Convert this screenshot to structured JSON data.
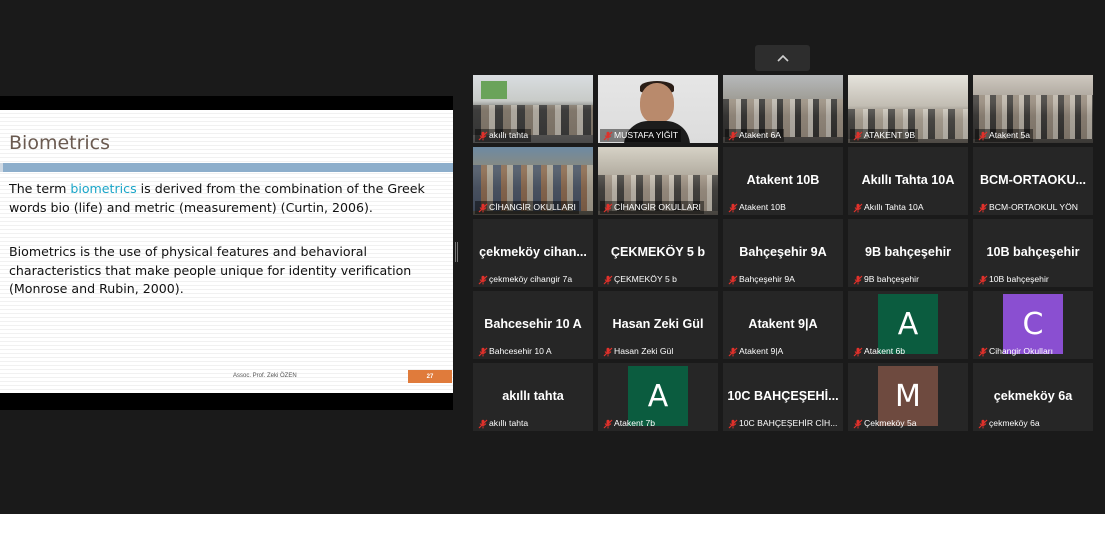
{
  "gallery_toggle": {
    "icon": "chevron-up-icon"
  },
  "slide": {
    "title": "Biometrics",
    "p1_before": "The term ",
    "p1_highlight": "biometrics",
    "p1_after": " is derived from the combination of the Greek words bio (life) and metric (measurement) (Curtin, 2006).",
    "p2": "Biometrics is the use of physical features and behavioral characteristics that make people unique for identity verification (Monrose and Rubin, 2000).",
    "footer": "Assoc. Prof. Zeki ÖZEN",
    "page": "27",
    "colors": {
      "title": "#6a5a50",
      "bar": "#8daecb",
      "highlight": "#1aa5c8",
      "page_badge": "#e07b3b"
    }
  },
  "participants": [
    {
      "name": "akıllı tahta",
      "video": "v-class1"
    },
    {
      "name": "MUSTAFA YİĞİT",
      "video": "v-person"
    },
    {
      "name": "Atakent 6A",
      "video": "v-class2"
    },
    {
      "name": "ATAKENT 9B",
      "video": "v-class3"
    },
    {
      "name": "Atakent 5a",
      "video": "v-class4"
    },
    {
      "name": "CİHANGİR OKULLARI",
      "video": "v-class5"
    },
    {
      "name": "CİHANGİR OKULLARI",
      "video": "v-class6"
    },
    {
      "name": "Atakent 10B",
      "big": "Atakent 10B"
    },
    {
      "name": "Akıllı Tahta 10A",
      "big": "Akıllı Tahta 10A"
    },
    {
      "name": "BCM-ORTAOKUL YÖN",
      "big": "BCM-ORTAOKU..."
    },
    {
      "name": "çekmeköy cihangir 7a",
      "big": "çekmeköy  cihan..."
    },
    {
      "name": "ÇEKMEKÖY 5 b",
      "big": "ÇEKMEKÖY 5 b"
    },
    {
      "name": "Bahçeşehir 9A",
      "big": "Bahçeşehir 9A"
    },
    {
      "name": "9B bahçeşehir",
      "big": "9B bahçeşehir"
    },
    {
      "name": "10B bahçeşehir",
      "big": "10B bahçeşehir"
    },
    {
      "name": "Bahcesehir 10 A",
      "big": "Bahcesehir 10 A"
    },
    {
      "name": "Hasan Zeki Gül",
      "big": "Hasan Zeki Gül"
    },
    {
      "name": "Atakent 9|A",
      "big": "Atakent 9|A"
    },
    {
      "name": "Atakent 6b",
      "avatar": "A",
      "avatar_color": "#0b5c3f"
    },
    {
      "name": "Cihangir Okulları",
      "avatar": "C",
      "avatar_color": "#8a4fd1"
    },
    {
      "name": "akıllı tahta",
      "big": "akıllı tahta"
    },
    {
      "name": "Atakent 7b",
      "avatar": "A",
      "avatar_color": "#0b5c3f"
    },
    {
      "name": "10C BAHÇEŞEHİR CİH...",
      "big": "10C  BAHÇEŞEHİ..."
    },
    {
      "name": "Çekmeköy 5a",
      "avatar": "M",
      "avatar_color": "#6e4a3f"
    },
    {
      "name": "çekmeköy 6a",
      "big": "çekmeköy 6a"
    }
  ]
}
